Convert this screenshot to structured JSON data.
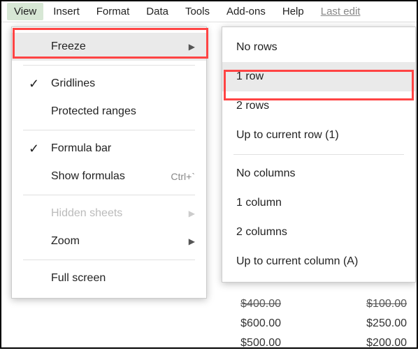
{
  "menubar": {
    "items": [
      "View",
      "Insert",
      "Format",
      "Data",
      "Tools",
      "Add-ons",
      "Help"
    ],
    "active_index": 0,
    "last_edit": "Last edit"
  },
  "view_menu": {
    "freeze": "Freeze",
    "gridlines": "Gridlines",
    "protected_ranges": "Protected ranges",
    "formula_bar": "Formula bar",
    "show_formulas": "Show formulas",
    "show_formulas_shortcut": "Ctrl+`",
    "hidden_sheets": "Hidden sheets",
    "zoom": "Zoom",
    "full_screen": "Full screen"
  },
  "freeze_menu": {
    "no_rows": "No rows",
    "one_row": "1 row",
    "two_rows": "2 rows",
    "up_to_row": "Up to current row (1)",
    "no_columns": "No columns",
    "one_column": "1 column",
    "two_columns": "2 columns",
    "up_to_column": "Up to current column (A)"
  },
  "sheet": {
    "cells": [
      [
        "$400.00",
        "$100.00"
      ],
      [
        "$600.00",
        "$250.00"
      ],
      [
        "$500.00",
        "$200.00"
      ]
    ]
  }
}
